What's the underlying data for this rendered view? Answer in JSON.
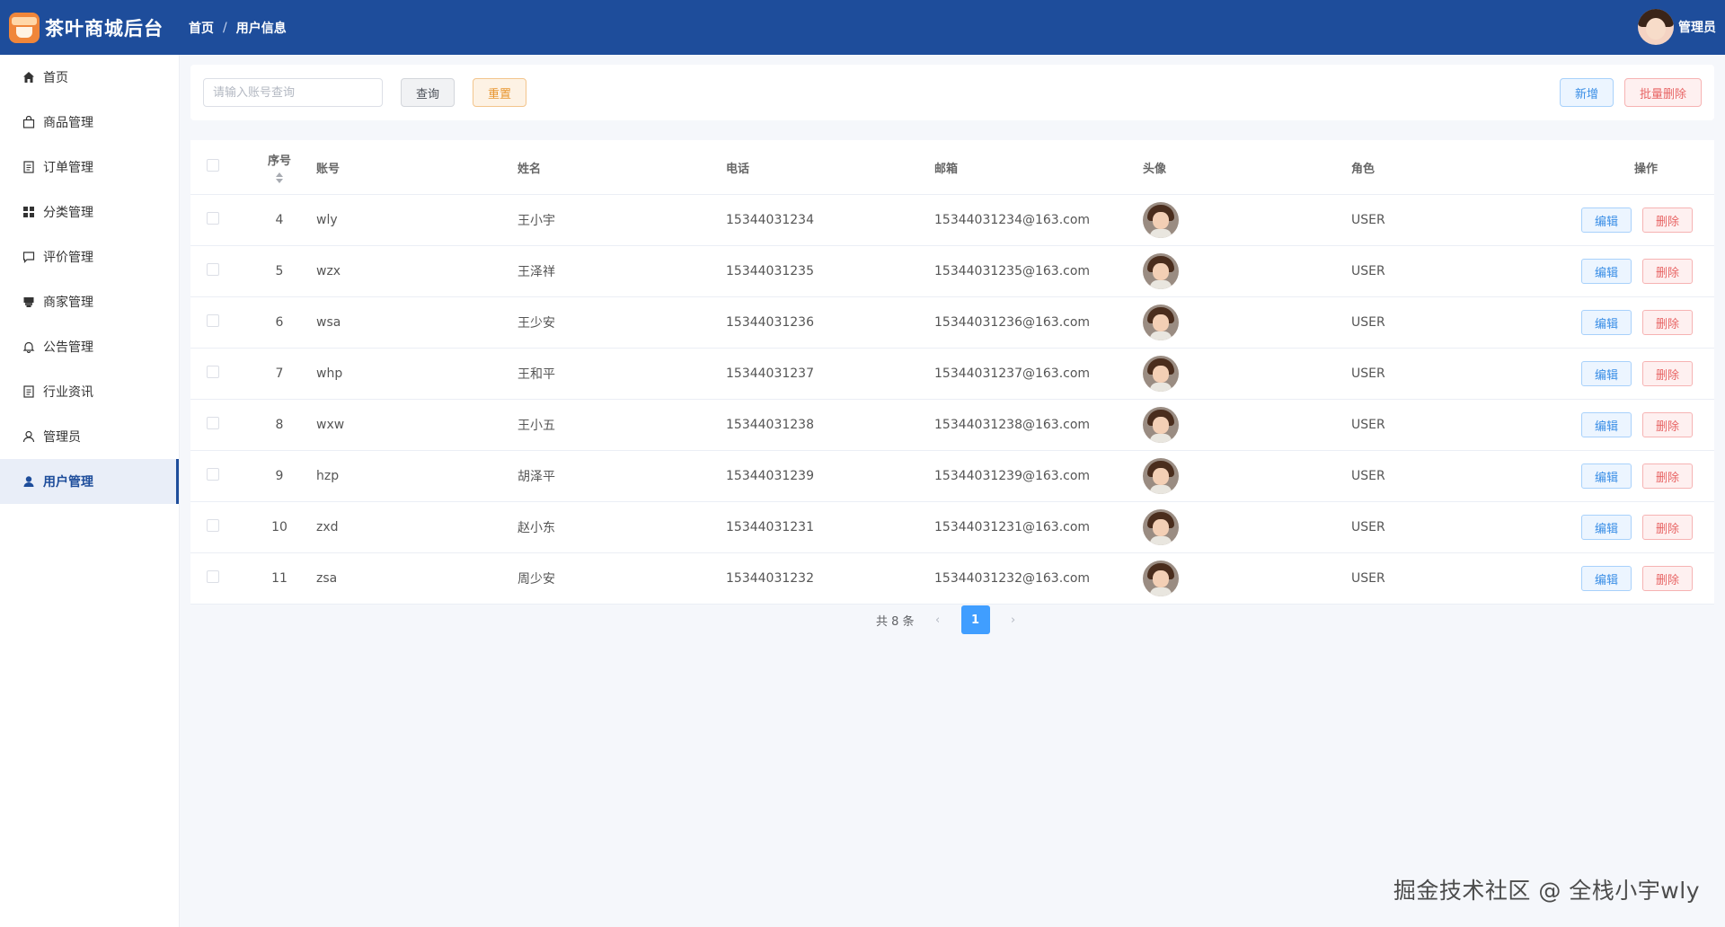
{
  "header": {
    "title": "茶叶商城后台",
    "breadcrumb": [
      "首页",
      "用户信息"
    ],
    "breadcrumb_sep": "/",
    "user_name": "管理员"
  },
  "sidebar": {
    "items": [
      {
        "label": "首页",
        "icon": "home-icon"
      },
      {
        "label": "商品管理",
        "icon": "bag-icon"
      },
      {
        "label": "订单管理",
        "icon": "document-icon"
      },
      {
        "label": "分类管理",
        "icon": "grid-icon"
      },
      {
        "label": "评价管理",
        "icon": "comment-icon"
      },
      {
        "label": "商家管理",
        "icon": "shop-icon"
      },
      {
        "label": "公告管理",
        "icon": "bell-icon"
      },
      {
        "label": "行业资讯",
        "icon": "document-icon"
      },
      {
        "label": "管理员",
        "icon": "user-icon"
      },
      {
        "label": "用户管理",
        "icon": "user-filled-icon",
        "active": true
      }
    ]
  },
  "search": {
    "placeholder": "请输入账号查询",
    "query_label": "查询",
    "reset_label": "重置",
    "add_label": "新增",
    "batch_delete_label": "批量删除"
  },
  "table": {
    "columns": [
      "序号",
      "账号",
      "姓名",
      "电话",
      "邮箱",
      "头像",
      "角色",
      "操作"
    ],
    "edit_label": "编辑",
    "delete_label": "删除",
    "rows": [
      {
        "id": "4",
        "account": "wly",
        "name": "王小宇",
        "phone": "15344031234",
        "email": "15344031234@163.com",
        "role": "USER"
      },
      {
        "id": "5",
        "account": "wzx",
        "name": "王泽祥",
        "phone": "15344031235",
        "email": "15344031235@163.com",
        "role": "USER"
      },
      {
        "id": "6",
        "account": "wsa",
        "name": "王少安",
        "phone": "15344031236",
        "email": "15344031236@163.com",
        "role": "USER"
      },
      {
        "id": "7",
        "account": "whp",
        "name": "王和平",
        "phone": "15344031237",
        "email": "15344031237@163.com",
        "role": "USER"
      },
      {
        "id": "8",
        "account": "wxw",
        "name": "王小五",
        "phone": "15344031238",
        "email": "15344031238@163.com",
        "role": "USER"
      },
      {
        "id": "9",
        "account": "hzp",
        "name": "胡泽平",
        "phone": "15344031239",
        "email": "15344031239@163.com",
        "role": "USER"
      },
      {
        "id": "10",
        "account": "zxd",
        "name": "赵小东",
        "phone": "15344031231",
        "email": "15344031231@163.com",
        "role": "USER"
      },
      {
        "id": "11",
        "account": "zsa",
        "name": "周少安",
        "phone": "15344031232",
        "email": "15344031232@163.com",
        "role": "USER"
      }
    ]
  },
  "pagination": {
    "total_label": "共 8 条",
    "current_page": "1",
    "prev": "‹",
    "next": "›"
  },
  "watermark": "掘金技术社区 @ 全栈小宇wly"
}
